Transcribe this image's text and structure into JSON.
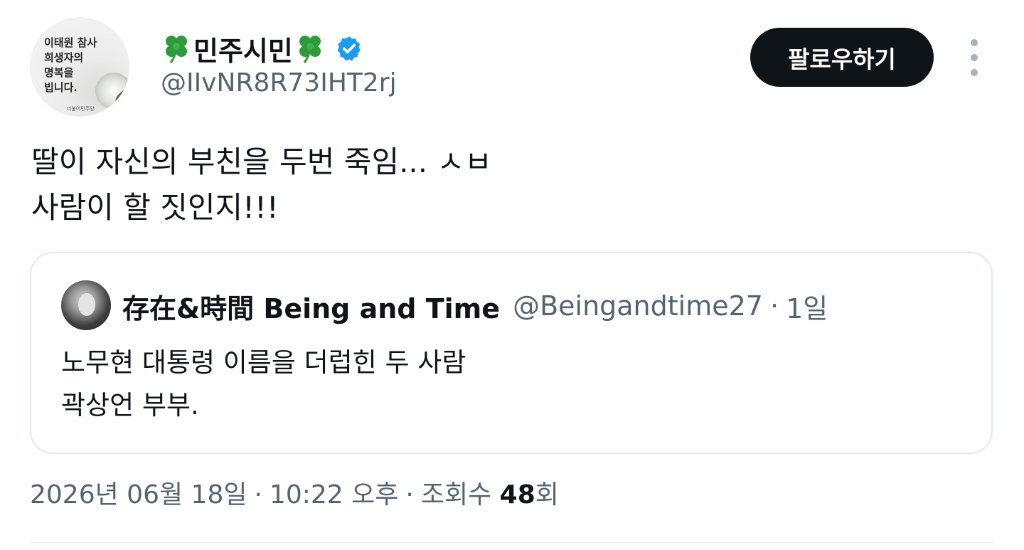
{
  "author": {
    "display_name": "민주시민",
    "name_emoji": "🍀",
    "handle": "@IIvNR8R73IHT2rj",
    "verified": true,
    "avatar_text_lines": [
      "이태원 참사",
      "희생자의",
      "명복을",
      "빕니다."
    ],
    "avatar_org_text": "더불어민주당"
  },
  "follow_button": {
    "label": "팔로우하기"
  },
  "tweet": {
    "text": "딸이 자신의 부친을 두번 죽임... ㅅㅂ\n사람이 할 짓인지!!!"
  },
  "quoted_tweet": {
    "name": "存在&時間 Being and Time",
    "handle": "@Beingandtime27",
    "separator": "·",
    "time": "1일",
    "text": "노무현 대통령 이름을 더럽힌 두 사람\n곽상언 부부."
  },
  "meta": {
    "date": "2026년 06월 18일",
    "time": "10:22 오후",
    "views_label": "조회수",
    "views_count": "48",
    "views_suffix": "회",
    "separator": "·"
  },
  "colors": {
    "text_primary": "#0f1419",
    "text_secondary": "#536471",
    "verified_blue": "#1d9bf0",
    "button_dark": "#0f1419",
    "border": "#e3e8eb",
    "clover_green": "#2f9a3c"
  }
}
